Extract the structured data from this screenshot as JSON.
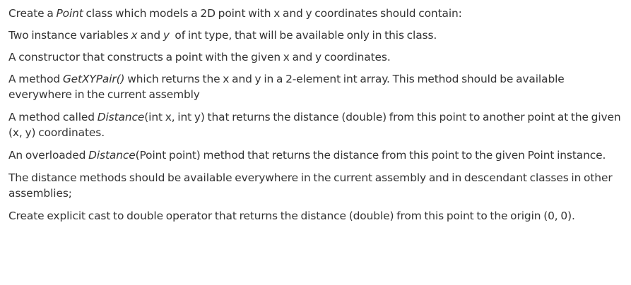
{
  "paragraphs": [
    {
      "text": [
        {
          "t": "Create a ",
          "i": false
        },
        {
          "t": "Point",
          "i": true
        },
        {
          "t": " class which models a 2D point with x and y coordinates should contain:",
          "i": false
        }
      ]
    },
    {
      "text": [
        {
          "t": "Two instance variables ",
          "i": false
        },
        {
          "t": "x",
          "i": true
        },
        {
          "t": " and ",
          "i": false
        },
        {
          "t": "y",
          "i": true
        },
        {
          "t": "  of int type, that will be available only in this class.",
          "i": false
        }
      ]
    },
    {
      "text": [
        {
          "t": "A constructor that constructs a point with the given x and y coordinates.",
          "i": false
        }
      ]
    },
    {
      "text": [
        {
          "t": "A method ",
          "i": false
        },
        {
          "t": "GetXYPair()",
          "i": true
        },
        {
          "t": " which returns the x and y in a 2-element int array. This method should be available everywhere in the current assembly",
          "i": false
        }
      ]
    },
    {
      "text": [
        {
          "t": "A method called ",
          "i": false
        },
        {
          "t": "Distance",
          "i": true
        },
        {
          "t": "(int x, int y) that returns the distance (double) from this point to another point at the given (x, y) coordinates.",
          "i": false
        }
      ]
    },
    {
      "text": [
        {
          "t": "An overloaded ",
          "i": false
        },
        {
          "t": "Distance",
          "i": true
        },
        {
          "t": "(Point point) method that returns the distance from this point to the given Point instance.",
          "i": false
        }
      ]
    },
    {
      "text": [
        {
          "t": "The distance methods should be available everywhere in the current assembly and in descendant classes in other assemblies;",
          "i": false
        }
      ]
    },
    {
      "text": [
        {
          "t": "Create explicit cast to double operator that returns the distance (double) from this point to the origin (0, 0).",
          "i": false
        }
      ]
    }
  ]
}
